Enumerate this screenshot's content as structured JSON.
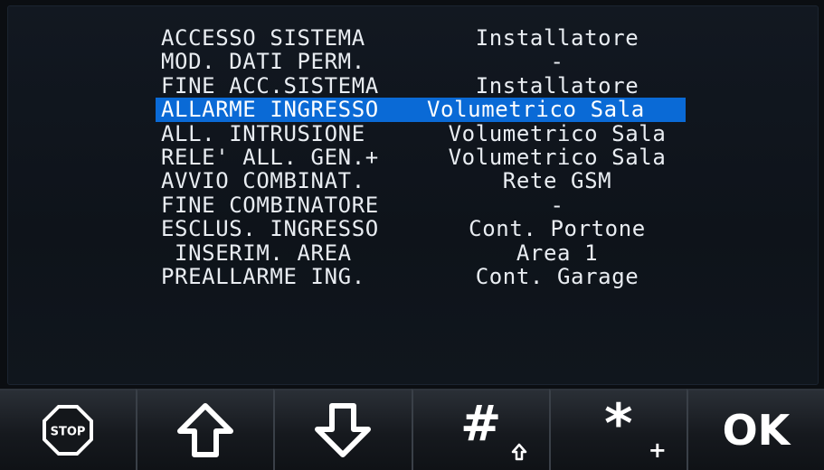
{
  "event_log": [
    {
      "event": "ACCESSO SISTEMA",
      "source": "Installatore",
      "selected": false
    },
    {
      "event": "MOD. DATI PERM.",
      "source": "-",
      "selected": false
    },
    {
      "event": "FINE ACC.SISTEMA",
      "source": "Installatore",
      "selected": false
    },
    {
      "event": "ALLARME INGRESSO",
      "source": "Volumetrico Sala",
      "selected": true
    },
    {
      "event": "ALL. INTRUSIONE",
      "source": "Volumetrico Sala",
      "selected": false
    },
    {
      "event": "RELE' ALL. GEN.+",
      "source": "Volumetrico Sala",
      "selected": false
    },
    {
      "event": "AVVIO COMBINAT.",
      "source": "Rete GSM",
      "selected": false
    },
    {
      "event": "FINE COMBINATORE",
      "source": "-",
      "selected": false
    },
    {
      "event": "ESCLUS. INGRESSO",
      "source": "Cont. Portone",
      "selected": false
    },
    {
      "event": " INSERIM. AREA",
      "source": "Area 1",
      "selected": false
    },
    {
      "event": "PREALLARME ING.",
      "source": "Cont. Garage",
      "selected": false
    }
  ],
  "keys": {
    "stop_label": "STOP",
    "hash_label": "#",
    "star_label": "*",
    "plus_label": "+",
    "ok_label": "OK"
  },
  "colors": {
    "selection": "#0a6ad6",
    "background": "#0b0e12",
    "text": "#e9edf2"
  },
  "icons": {
    "stop": "stop-sign-icon",
    "up": "arrow-up-icon",
    "down": "arrow-down-icon",
    "hash_sub": "small-arrow-up-icon"
  }
}
